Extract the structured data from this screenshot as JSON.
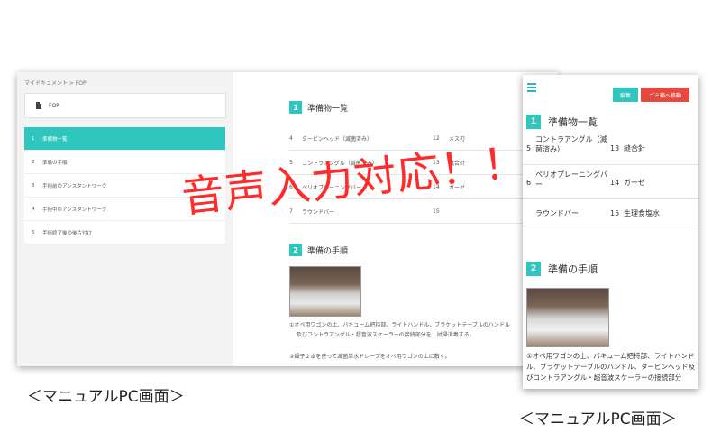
{
  "desktop": {
    "breadcrumb": "マイドキュメント > FOP",
    "doc_label": "FOP",
    "nav": [
      {
        "num": "1",
        "label": "準備物一覧"
      },
      {
        "num": "2",
        "label": "準備の手順"
      },
      {
        "num": "3",
        "label": "手術前のアシスタントワーク"
      },
      {
        "num": "4",
        "label": "手術中のアシスタントワーク"
      },
      {
        "num": "5",
        "label": "手術終了後の後片付け"
      }
    ],
    "section1": {
      "num": "1",
      "title": "準備物一覧"
    },
    "table": [
      {
        "n1": "4",
        "a": "タービンヘッド（滅菌済み）",
        "n2": "12",
        "b": "メス刃"
      },
      {
        "n1": "5",
        "a": "コントラアングル（滅菌済み）",
        "n2": "13",
        "b": "縫合針"
      },
      {
        "n1": "6",
        "a": "ペリオプレーニングバー",
        "n2": "14",
        "b": "ガーゼ"
      },
      {
        "n1": "7",
        "a": "ラウンドバー",
        "n2": "15",
        "b": ""
      }
    ],
    "section2": {
      "num": "2",
      "title": "準備の手順"
    },
    "step1_line1": "①オペ用ワゴンの上、バキューム把持部、ライトハンドル、ブラケットテーブルのハンドル",
    "step1_line2": "及びコントラアングル・超音波スケーラーの接続部分を　拭掃消毒する。",
    "step2": "②鑷子２本を使って滅菌単水ドレープをオペ用ワゴンの上に敷く。"
  },
  "phone": {
    "edit_button": "編集",
    "trash_button": "ゴミ箱へ移動",
    "section1": {
      "num": "1",
      "title": "準備物一覧"
    },
    "rows": [
      {
        "n1": "5",
        "a": "コントラアングル（滅菌済み）",
        "n2": "13",
        "b": "縫合針"
      },
      {
        "n1": "6",
        "a": "ペリオプレーニングバー",
        "n2": "14",
        "b": "ガーゼ"
      },
      {
        "n1": "",
        "a": "ラウンドバー",
        "n2": "15",
        "b": "生理食塩水"
      }
    ],
    "section2": {
      "num": "2",
      "title": "準備の手順"
    },
    "step1": "①オペ用ワゴンの上、バキューム把持部、ライトハンドル、ブラケットテーブルのハンドル、タービンヘッド及びコントラアングル・超音波スケーラーの接続部分"
  },
  "overlay_text": "音声入力対応！！",
  "caption_left": "＜マニュアルPC画面＞",
  "caption_right": "＜マニュアルPC画面＞",
  "colors": {
    "accent": "#2fc6bd",
    "danger": "#e8493e",
    "overlay": "#ff2a2a"
  }
}
